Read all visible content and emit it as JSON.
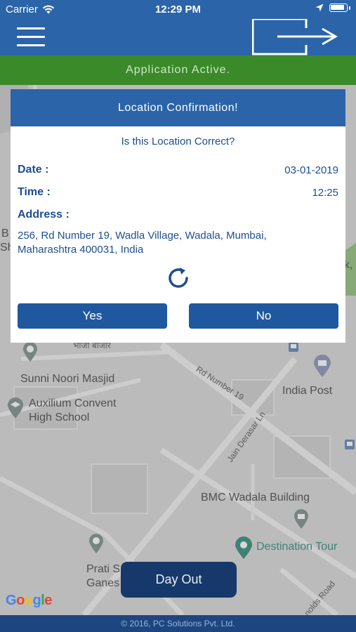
{
  "status_bar": {
    "carrier": "Carrier",
    "time": "12:29 PM"
  },
  "banner": {
    "text": "Application Active."
  },
  "dialog": {
    "title": "Location Confirmation!",
    "question": "Is this Location Correct?",
    "date_label": "Date :",
    "date_value": "03-01-2019",
    "time_label": "Time :",
    "time_value": "12:25",
    "address_label": "Address :",
    "address_line1": "256, Rd Number 19, Wadla Village, Wadala, Mumbai,",
    "address_line2": "Maharashtra 400031, India",
    "yes_label": "Yes",
    "no_label": "No"
  },
  "map": {
    "labels": {
      "market": "भाजी बाजार",
      "masjid": "Sunni Noori Masjid",
      "convent_1": "Auxilium Convent",
      "convent_2": "High School",
      "road_19": "Rd Number 19",
      "india_post": "India Post",
      "jain": "Jain Derasar Ln",
      "bmc": "BMC Wadala Building",
      "destination": "Destination Tour",
      "prati_1": "Prati S",
      "prati_2": "Ganes",
      "reynolds": "nolds Road",
      "edge_b": "B",
      "edge_sh": "Sh",
      "edge_k": "k,"
    },
    "google": "Google"
  },
  "day_out": {
    "label": "Day Out"
  },
  "footer": {
    "text": "© 2016, PC Solutions Pvt. Ltd."
  },
  "colors": {
    "primary_blue": "#2b64a8",
    "active_green": "#3a8a2a",
    "button_blue": "#2058a0",
    "dayout_blue": "#17386a"
  }
}
